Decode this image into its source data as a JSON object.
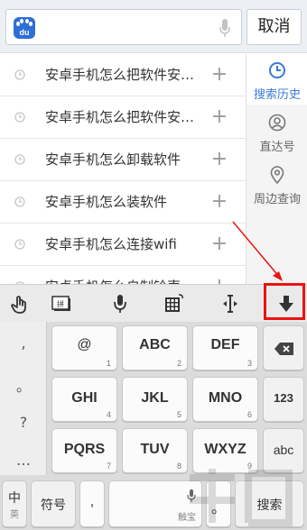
{
  "search": {
    "cancel_label": "取消"
  },
  "history": [
    {
      "text": "安卓手机怎么把软件安…"
    },
    {
      "text": "安卓手机怎么把软件安…"
    },
    {
      "text": "安卓手机怎么卸载软件"
    },
    {
      "text": "安卓手机怎么装软件"
    },
    {
      "text": "安卓手机怎么连接wifi"
    },
    {
      "text": "安卓手机怎么自制铃声"
    }
  ],
  "tabs": [
    {
      "label": "搜索历史",
      "icon": "clock-icon",
      "active": true
    },
    {
      "label": "直达号",
      "icon": "person-icon"
    },
    {
      "label": "周边查询",
      "icon": "location-pin-icon"
    }
  ],
  "keyboard": {
    "left_punct": [
      ",",
      "。",
      "?",
      "…"
    ],
    "rows": [
      [
        {
          "main": "@",
          "num": "1"
        },
        {
          "main": "ABC",
          "num": "2"
        },
        {
          "main": "DEF",
          "num": "3"
        }
      ],
      [
        {
          "main": "GHI",
          "num": "4"
        },
        {
          "main": "JKL",
          "num": "5"
        },
        {
          "main": "MNO",
          "num": "6"
        }
      ],
      [
        {
          "main": "PQRS",
          "num": "7"
        },
        {
          "main": "TUV",
          "num": "8"
        },
        {
          "main": "WXYZ",
          "num": "9"
        }
      ]
    ],
    "right": {
      "num_label": "123",
      "abc_label": "abc"
    },
    "bottom": {
      "lang_main": "中",
      "lang_sub": "英",
      "symbol": "符号",
      "comma": ",",
      "space_sub": "触宝",
      "search": "搜索"
    }
  },
  "colors": {
    "accent": "#3a7bd5",
    "highlight": "#e11111",
    "baidu_blue": "#2f6ed7"
  }
}
